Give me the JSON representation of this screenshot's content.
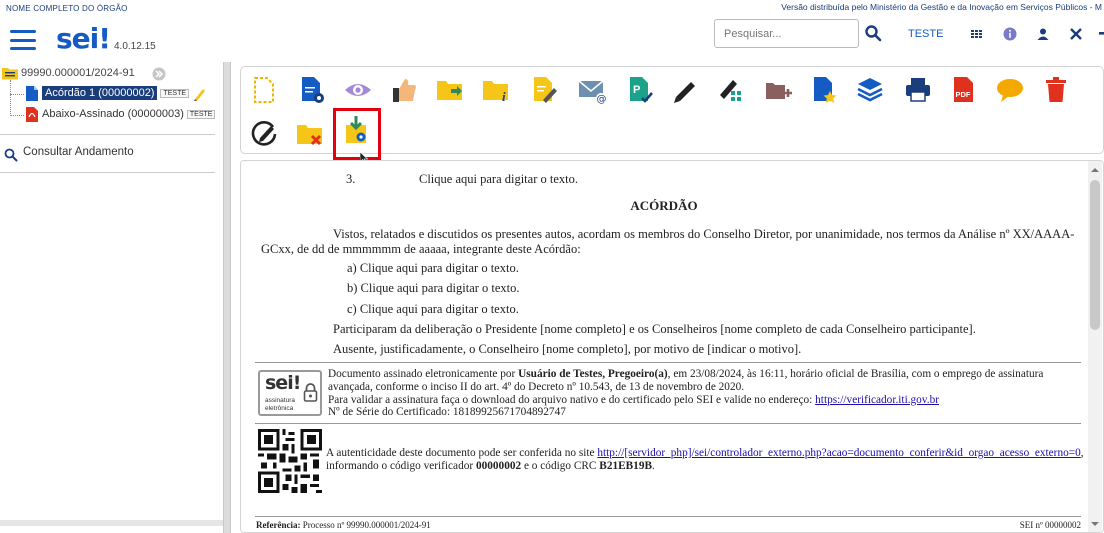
{
  "header": {
    "org_name": "NOME COMPLETO DO ÓRGÃO",
    "gov_text": "Versão distribuída pelo Ministério da Gestão e da Inovação em Serviços Públicos - M",
    "logo": "sei!",
    "version": "4.0.12.15",
    "search_placeholder": "Pesquisar...",
    "user": "TESTE"
  },
  "tree": {
    "process": "99990.000001/2024-91",
    "doc1": "Acórdão 1 (00000002)",
    "doc1_badge": "TESTE",
    "doc2": "Abaixo-Assinado (00000003)",
    "doc2_badge": "TESTE",
    "consult": "Consultar Andamento"
  },
  "toolbar": {
    "icons": [
      "new-document-icon",
      "edit-doc-settings-icon",
      "view-icon",
      "thumbs-up-icon",
      "move-folder-icon",
      "folder-info-icon",
      "edit-content-icon",
      "email-icon",
      "sign-check-icon",
      "pen-icon",
      "pen-grid-icon",
      "add-block-icon",
      "favorite-doc-icon",
      "layers-icon",
      "print-icon",
      "pdf-icon",
      "comment-icon",
      "trash-icon",
      "edit-circle-icon",
      "folder-cancel-icon",
      "download-settings-icon"
    ]
  },
  "document": {
    "item3_num": "3.",
    "item3_text": "Clique aqui para digitar o texto.",
    "title": "ACÓRDÃO",
    "para1_line1": "Vistos, relatados e discutidos os presentes autos, acordam os membros do Conselho Diretor, por unanimidade, nos termos da Análise nº XX/AAAA-",
    "para1_line2": "GCxx, de dd de mmmmmm de aaaaa, integrante deste Acórdão:",
    "item_a": "a)  Clique aqui para digitar o texto.",
    "item_b": "b)  Clique aqui para digitar o texto.",
    "item_c": "c)  Clique aqui para digitar o texto.",
    "para2": "Participaram da deliberação o Presidente [nome completo] e os Conselheiros [nome completo de cada Conselheiro participante].",
    "para3": "Ausente, justificadamente, o Conselheiro [nome completo], por motivo de [indicar o motivo].",
    "sig_pre": "Documento assinado eletronicamente por ",
    "sig_name": "Usuário de Testes, Pregoeiro(a)",
    "sig_post": ", em 23/08/2024, às 16:11, horário oficial de Brasília, com o emprego de assinatura",
    "sig_line2": "avançada, conforme o inciso II do art. 4º do Decreto nº 10.543, de 13 de novembro de 2020.",
    "sig_line3_pre": "Para validar a assinatura faça o download do arquivo nativo e do certificado pelo SEI e valide no endereço: ",
    "sig_link": "https://verificador.iti.gov.br",
    "sig_line4": "Nº de Série do Certificado: 18189925671704892747",
    "seal_logo": "sei!",
    "seal_text1": "assinatura",
    "seal_text2": "eletrônica",
    "auth_pre": "A autenticidade deste documento pode ser conferida no site ",
    "auth_link": "http://[servidor_php]/sei/controlador_externo.php?acao=documento_conferir&id_orgao_acesso_externo=0",
    "auth_post": ",",
    "auth_line2_pre": "informando o código verificador ",
    "auth_code": "00000002",
    "auth_line2_mid": " e o código CRC ",
    "auth_crc": "B21EB19B",
    "auth_line2_end": ".",
    "footer_ref_label": "Referência:",
    "footer_ref": " Processo nº 99990.000001/2024-91",
    "footer_sei": "SEI nº 00000002"
  },
  "colors": {
    "accent": "#155bc4",
    "highlight": "#e3000f",
    "selected": "#1a3d7c"
  }
}
